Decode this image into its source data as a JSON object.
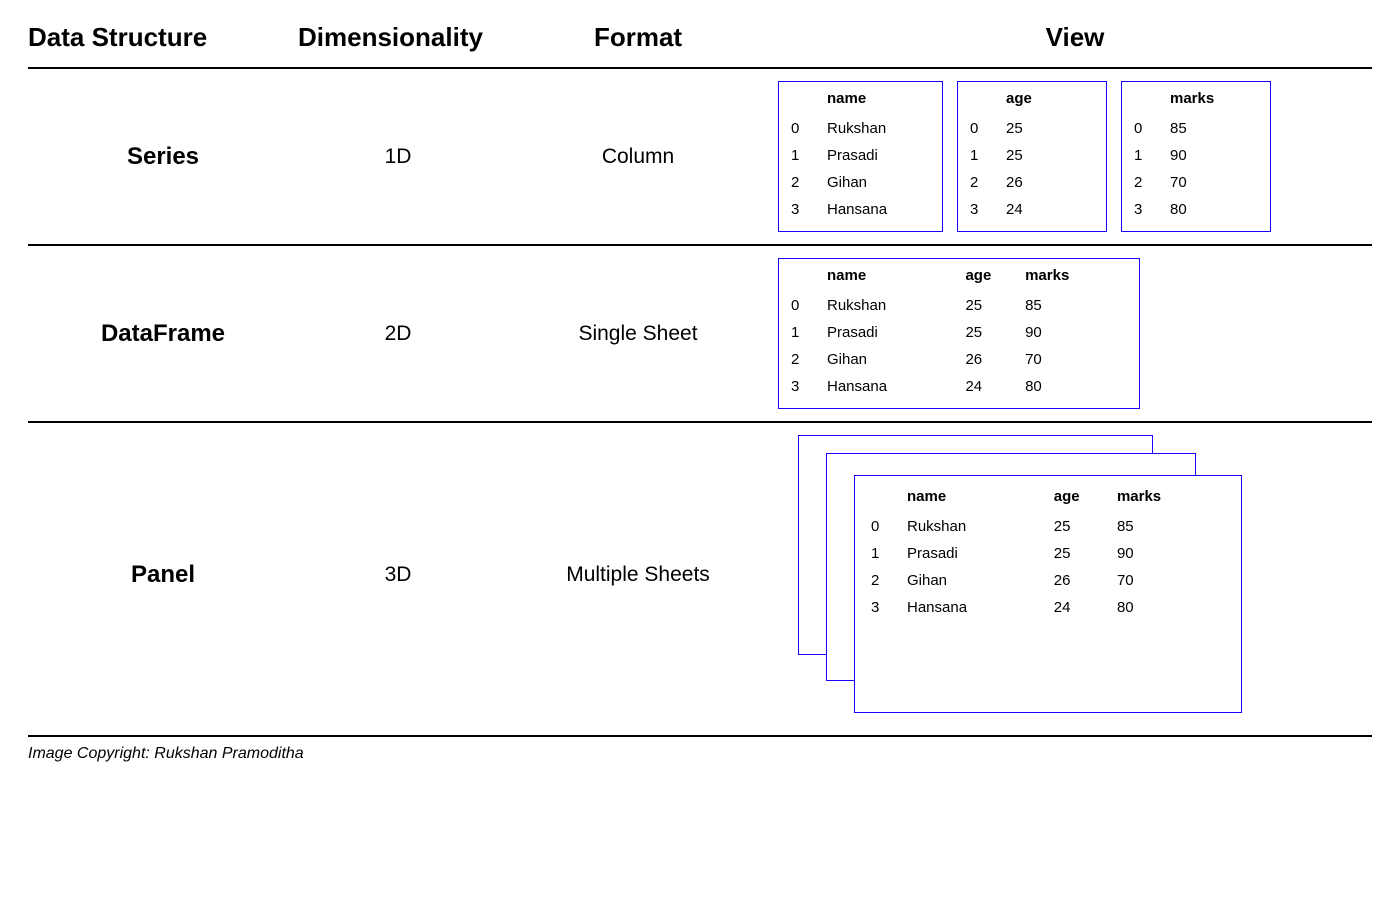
{
  "headers": {
    "data_structure": "Data Structure",
    "dimensionality": "Dimensionality",
    "format": "Format",
    "view": "View"
  },
  "rows": {
    "series": {
      "label": "Series",
      "dim": "1D",
      "format": "Column",
      "cols": {
        "name": {
          "header": "name",
          "values": [
            "Rukshan",
            "Prasadi",
            "Gihan",
            "Hansana"
          ]
        },
        "age": {
          "header": "age",
          "values": [
            "25",
            "25",
            "26",
            "24"
          ]
        },
        "marks": {
          "header": "marks",
          "values": [
            "85",
            "90",
            "70",
            "80"
          ]
        }
      },
      "index": [
        "0",
        "1",
        "2",
        "3"
      ]
    },
    "dataframe": {
      "label": "DataFrame",
      "dim": "2D",
      "format": "Single Sheet",
      "headers": [
        "name",
        "age",
        "marks"
      ],
      "index": [
        "0",
        "1",
        "2",
        "3"
      ],
      "data": [
        [
          "Rukshan",
          "25",
          "85"
        ],
        [
          "Prasadi",
          "25",
          "90"
        ],
        [
          "Gihan",
          "26",
          "70"
        ],
        [
          "Hansana",
          "24",
          "80"
        ]
      ]
    },
    "panel": {
      "label": "Panel",
      "dim": "3D",
      "format": "Multiple Sheets",
      "headers": [
        "name",
        "age",
        "marks"
      ],
      "index": [
        "0",
        "1",
        "2",
        "3"
      ],
      "data": [
        [
          "Rukshan",
          "25",
          "85"
        ],
        [
          "Prasadi",
          "25",
          "90"
        ],
        [
          "Gihan",
          "26",
          "70"
        ],
        [
          "Hansana",
          "24",
          "80"
        ]
      ]
    }
  },
  "copyright": "Image Copyright: Rukshan Pramoditha"
}
